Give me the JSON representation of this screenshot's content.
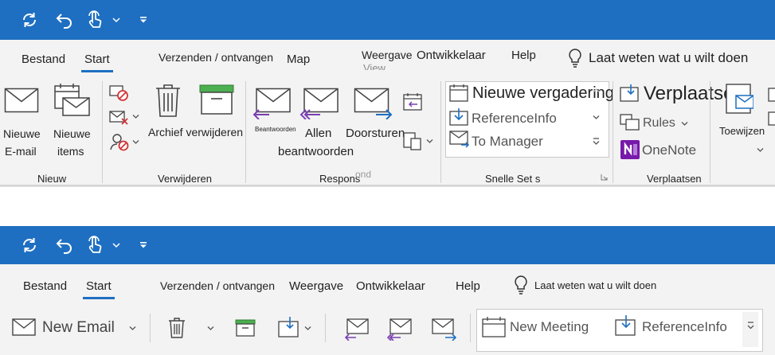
{
  "colors": {
    "accent": "#1e6fc1",
    "ribbon_bg": "#f3f3f3",
    "purple": "#7a3fb2",
    "onenote": "#7719aa",
    "red": "#d13438",
    "green": "#4caf50"
  },
  "top": {
    "tabs": [
      "Bestand",
      "Start",
      "Verzenden / ontvangen",
      "Map",
      "Weergave",
      "Ontwikkelaar",
      "Help"
    ],
    "ghost_tab": "View",
    "tell_me": "Laat weten wat u wilt doen",
    "buttons": {
      "new_email": [
        "Nieuwe",
        "E-mail"
      ],
      "new_items": [
        "Nieuwe",
        "items"
      ],
      "archive_delete": "Archief verwijderen",
      "reply": "Beantwoorden",
      "reply_all": [
        "Allen",
        "beantwoorden"
      ],
      "forward": "Doorsturen",
      "new_meeting": "Nieuwe vergadering",
      "reference_info": "ReferenceInfo",
      "to_manager": "To Manager",
      "move": "Verplaatsen",
      "rules": "Rules",
      "onenote": "OneNote",
      "assign": "Toewijzen"
    },
    "groups": {
      "new": "Nieuw",
      "delete": "Verwijderen",
      "respond": "Respons",
      "respond_ghost": "ond",
      "quick_steps": "Snelle Set s",
      "move": "Verplaatsen"
    }
  },
  "bottom": {
    "tabs": [
      "Bestand",
      "Start",
      "Verzenden / ontvangen",
      "Weergave",
      "Ontwikkelaar",
      "Help"
    ],
    "tell_me": "Laat weten wat u wilt doen",
    "buttons": {
      "new_email": "New Email",
      "new_meeting": "New Meeting",
      "reference_info": "ReferenceInfo"
    }
  }
}
